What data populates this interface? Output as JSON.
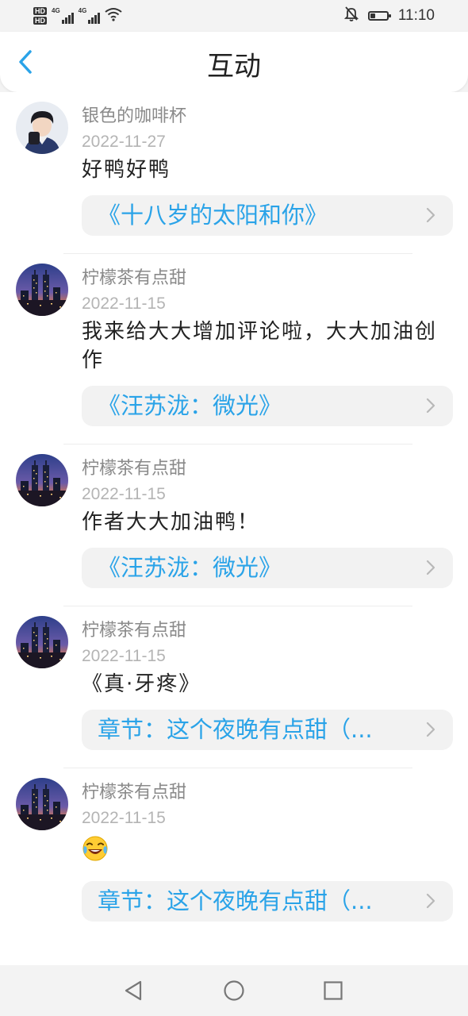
{
  "status_bar": {
    "hd1": "HD",
    "hd2": "HD",
    "net1": "4G",
    "net2": "4G",
    "time": "11:10",
    "battery_level": 0.3
  },
  "header": {
    "title": "互动"
  },
  "comments": [
    {
      "username": "银色的咖啡杯",
      "date": "2022-11-27",
      "text": "好鸭好鸭",
      "link": "《十八岁的太阳和你》",
      "avatar": "boy-photo"
    },
    {
      "username": "柠檬茶有点甜",
      "date": "2022-11-15",
      "text": "我来给大大增加评论啦，大大加油创作",
      "link": "《汪苏泷：微光》",
      "avatar": "city-night"
    },
    {
      "username": "柠檬茶有点甜",
      "date": "2022-11-15",
      "text": "作者大大加油鸭！",
      "link": "《汪苏泷：微光》",
      "avatar": "city-night"
    },
    {
      "username": "柠檬茶有点甜",
      "date": "2022-11-15",
      "text": "《真·牙疼》",
      "link": "章节：这个夜晚有点甜（...",
      "avatar": "city-night"
    },
    {
      "username": "柠檬茶有点甜",
      "date": "2022-11-15",
      "text": "",
      "emoji": "laughing-tears-emoji",
      "link": "章节：这个夜晚有点甜（...",
      "avatar": "city-night"
    }
  ],
  "colors": {
    "link": "#2aa3e8",
    "back": "#2aa3e8"
  }
}
